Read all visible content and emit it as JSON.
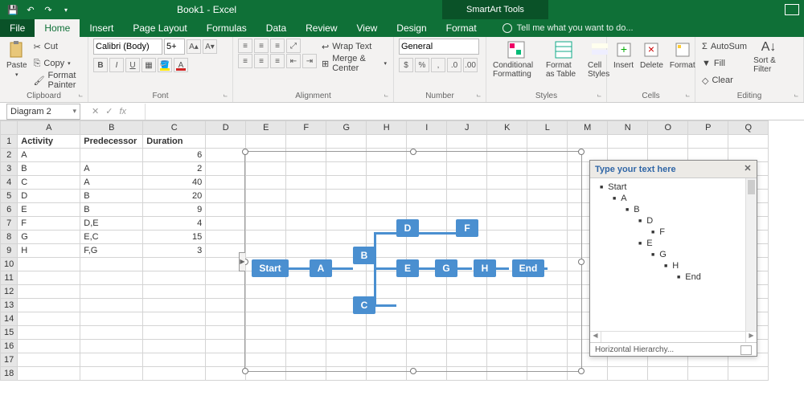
{
  "titlebar": {
    "doc": "Book1 - Excel",
    "context_tools": "SmartArt Tools"
  },
  "tabs": {
    "file": "File",
    "list": [
      "Home",
      "Insert",
      "Page Layout",
      "Formulas",
      "Data",
      "Review",
      "View",
      "Design",
      "Format"
    ],
    "active": "Home",
    "tell_me": "Tell me what you want to do..."
  },
  "ribbon": {
    "clipboard": {
      "paste": "Paste",
      "cut": "Cut",
      "copy": "Copy",
      "painter": "Format Painter",
      "label": "Clipboard"
    },
    "font": {
      "name": "Calibri (Body)",
      "size": "5+",
      "label": "Font",
      "bold": "B",
      "italic": "I",
      "underline": "U"
    },
    "alignment": {
      "wrap": "Wrap Text",
      "merge": "Merge & Center",
      "label": "Alignment"
    },
    "number": {
      "format": "General",
      "label": "Number"
    },
    "styles": {
      "cond": "Conditional Formatting",
      "table": "Format as Table",
      "cell": "Cell Styles",
      "label": "Styles"
    },
    "cells": {
      "insert": "Insert",
      "delete": "Delete",
      "format": "Format",
      "label": "Cells"
    },
    "editing": {
      "autosum": "AutoSum",
      "fill": "Fill",
      "clear": "Clear",
      "sort": "Sort & Filter",
      "label": "Editing"
    }
  },
  "fxrow": {
    "namebox": "Diagram 2",
    "fx": "fx"
  },
  "sheet": {
    "cols": [
      "A",
      "B",
      "C",
      "D",
      "E",
      "F",
      "G",
      "H",
      "I",
      "J",
      "K",
      "L",
      "M",
      "N",
      "O",
      "P",
      "Q"
    ],
    "headers": [
      "Activity",
      "Predecessor",
      "Duration"
    ],
    "rows": [
      {
        "a": "A",
        "p": "",
        "d": "6"
      },
      {
        "a": "B",
        "p": "A",
        "d": "2"
      },
      {
        "a": "C",
        "p": "A",
        "d": "40"
      },
      {
        "a": "D",
        "p": "B",
        "d": "20"
      },
      {
        "a": "E",
        "p": "B",
        "d": "9"
      },
      {
        "a": "F",
        "p": "D,E",
        "d": "4"
      },
      {
        "a": "G",
        "p": "E,C",
        "d": "15"
      },
      {
        "a": "H",
        "p": "F,G",
        "d": "3"
      }
    ]
  },
  "smartart": {
    "nodes": {
      "start": "Start",
      "a": "A",
      "b": "B",
      "c": "C",
      "d": "D",
      "e": "E",
      "f": "F",
      "g": "G",
      "h": "H",
      "end": "End"
    }
  },
  "textpane": {
    "title": "Type your text here",
    "items": [
      {
        "indent": 0,
        "text": "Start"
      },
      {
        "indent": 1,
        "text": "A"
      },
      {
        "indent": 2,
        "text": "B"
      },
      {
        "indent": 3,
        "text": "D"
      },
      {
        "indent": 4,
        "text": "F"
      },
      {
        "indent": 3,
        "text": "E"
      },
      {
        "indent": 4,
        "text": "G"
      },
      {
        "indent": 5,
        "text": "H"
      },
      {
        "indent": 6,
        "text": "End"
      }
    ],
    "footer": "Horizontal Hierarchy..."
  }
}
